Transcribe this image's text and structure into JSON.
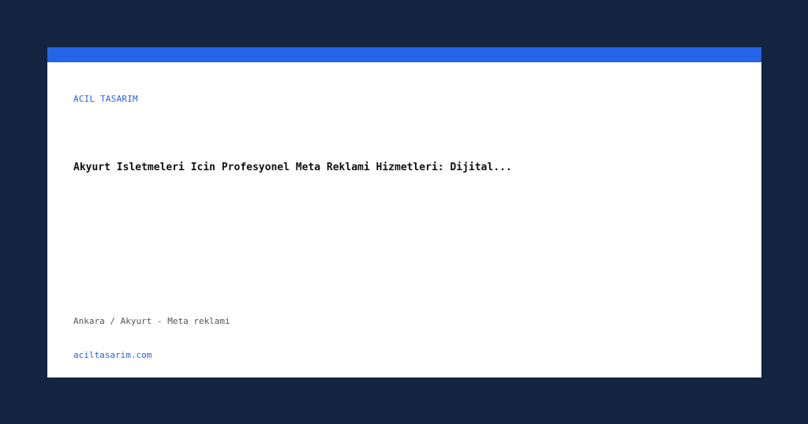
{
  "colors": {
    "page_background": "#132440",
    "card_background": "#ffffff",
    "accent": "#2563e8",
    "headline": "#111111",
    "meta": "#555555"
  },
  "card": {
    "brand": "ACIL TASARIM",
    "headline": "Akyurt Isletmeleri Icin Profesyonel Meta Reklami Hizmetleri: Dijital...",
    "meta": "Ankara / Akyurt - Meta reklami",
    "domain": "aciltasarim.com"
  }
}
